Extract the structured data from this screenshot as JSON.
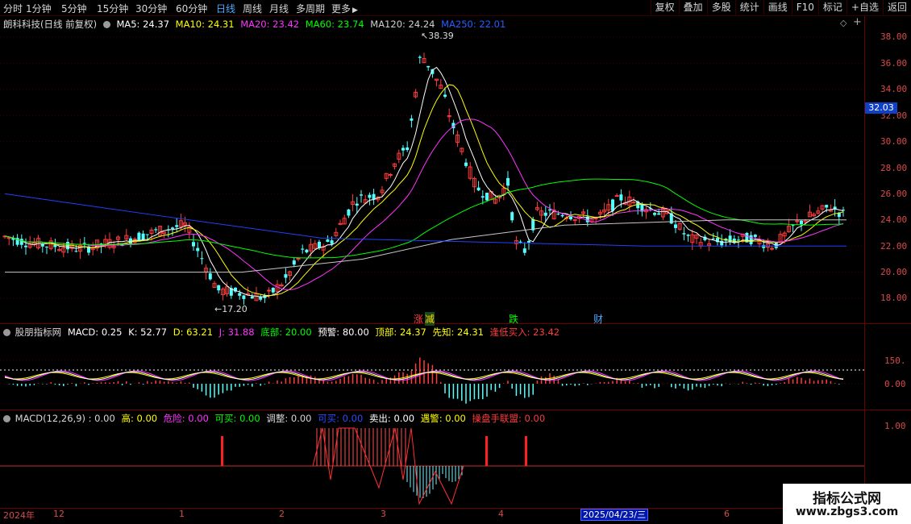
{
  "toolbar": {
    "timeframes": [
      "分时",
      "1分钟",
      "5分钟",
      "15分钟",
      "30分钟",
      "60分钟",
      "日线",
      "周线",
      "月线",
      "多周期",
      "更多"
    ],
    "more_arrow": "▶",
    "active": "日线",
    "right_buttons": [
      "复权",
      "叠加",
      "多股",
      "统计",
      "画线",
      "F10",
      "标记",
      "+自选",
      "返回"
    ]
  },
  "main_legend": {
    "title": "朗科科技(日线 前复权)",
    "ma5": "MA5: 24.37",
    "ma10": "MA10: 24.31",
    "ma20": "MA20: 23.42",
    "ma60": "MA60: 23.74",
    "ma120": "MA120: 24.24",
    "ma250": "MA250: 22.01"
  },
  "yaxis_main": [
    "38.00",
    "36.00",
    "34.00",
    "32.00",
    "30.00",
    "28.00",
    "26.00",
    "24.00",
    "22.00",
    "20.00",
    "18.00"
  ],
  "price_tag": "32.03",
  "annotations": {
    "high": "38.39",
    "low": "17.20",
    "signal1": "涨",
    "signal2": "减",
    "signal3": "跌",
    "signal4": "财"
  },
  "ind1_legend": {
    "name": "股朋指标网",
    "macd": "MACD: 0.25",
    "k": "K: 52.77",
    "d": "D: 63.21",
    "j": "J: 31.88",
    "bottom": "底部: 20.00",
    "warn": "预警: 80.00",
    "top": "顶部: 24.37",
    "pre": "先知: 24.31",
    "buy": "逢低买入: 23.42"
  },
  "yaxis_ind1": [
    "150.",
    "0.00"
  ],
  "ind2_legend": {
    "name": "MACD(12,26,9)",
    "v": ": 0.00",
    "high": "高: 0.00",
    "danger": "危险: 0.00",
    "canbuy": "可买: 0.00",
    "adjust": "调整: 0.00",
    "canbuy2": "可买: 0.00",
    "sell": "卖出: 0.00",
    "meetwarn": "遇警: 0.00",
    "alliance": "操盘手联盟: 0.00"
  },
  "yaxis_ind2": [
    "1.00"
  ],
  "xaxis": {
    "year": "2024年",
    "ticks": [
      "12",
      "1",
      "2",
      "3",
      "4",
      "6"
    ],
    "cursor_date": "2025/04/23/三"
  },
  "watermark": {
    "line1": "指标公式网",
    "line2": "www.zbgs3.com"
  },
  "colors": {
    "up": "#ff3c3c",
    "down": "#54ffff",
    "ma5": "#ffffff",
    "ma10": "#ffff00",
    "ma20": "#ff33ff",
    "ma60": "#00ff00",
    "ma120": "#c8c8c8",
    "ma250": "#2040ff",
    "grid": "#6b0000"
  }
}
